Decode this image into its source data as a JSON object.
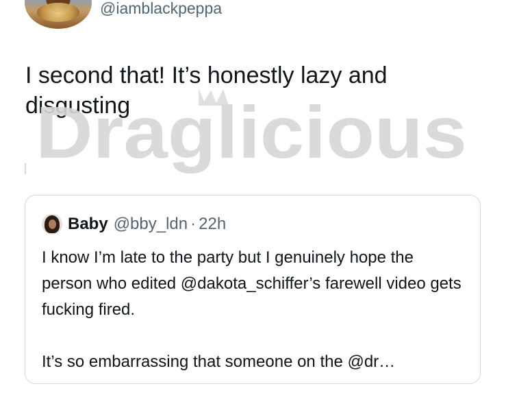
{
  "tweet": {
    "handle": "@iamblackpeppa",
    "text": "I second that! It’s honestly lazy and disgusting",
    "avatar_icon": "user-avatar"
  },
  "watermark": {
    "text": "Draglicious"
  },
  "quoted_tweet": {
    "name": "Baby",
    "handle": "@bby_ldn",
    "separator": "·",
    "time": "22h",
    "body_line1": "I know I’m late to the party but I genuinely hope the person who edited @dakota_schiffer’s farewell video gets fucking fired.",
    "body_line2": "It’s so embarrassing that someone on the @dr…",
    "avatar_icon": "user-avatar"
  },
  "colors": {
    "text_primary": "#0f1419",
    "text_secondary": "#536471",
    "border": "#cfd9de",
    "watermark": "#dcdcdc"
  }
}
